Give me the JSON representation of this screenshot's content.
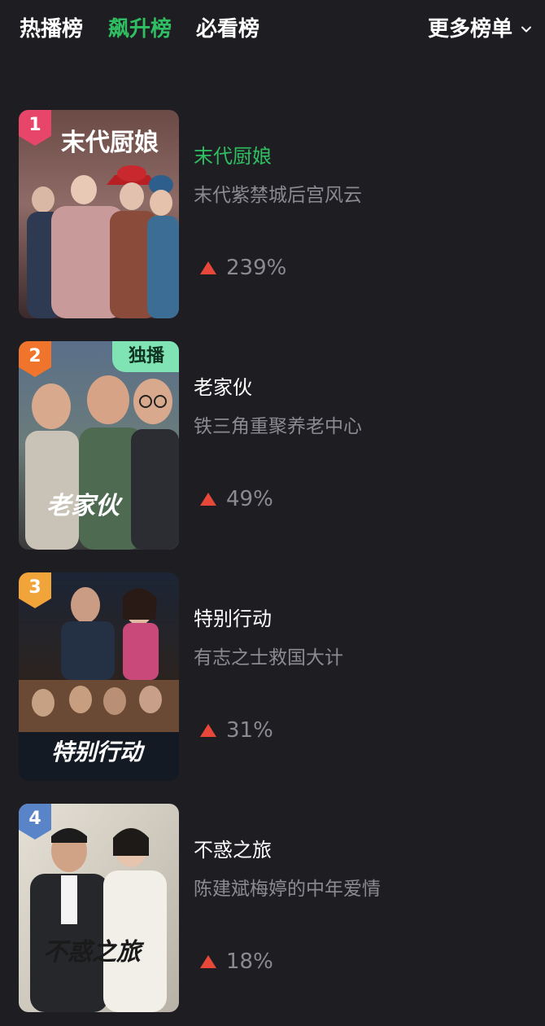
{
  "tabs": [
    {
      "label": "热播榜",
      "active": false
    },
    {
      "label": "飙升榜",
      "active": true
    },
    {
      "label": "必看榜",
      "active": false
    }
  ],
  "more": {
    "label": "更多榜单",
    "icon": "chevron-down-icon"
  },
  "colors": {
    "background": "#1e1d22",
    "accent_green": "#2fbf62",
    "muted_text": "#8b8a90",
    "trend_up": "#e8483a",
    "rank_1": "#e8456a",
    "rank_2": "#f0742c",
    "rank_3": "#f1a43a",
    "rank_4": "#5a84c8",
    "exclusive_badge": "#7fe3b3"
  },
  "items": [
    {
      "rank": "1",
      "title": "末代厨娘",
      "subtitle": "末代紫禁城后宫风云",
      "trend": "239%",
      "poster_text": "末代厨娘",
      "highlighted": true
    },
    {
      "rank": "2",
      "title": "老家伙",
      "subtitle": "铁三角重聚养老中心",
      "trend": "49%",
      "badge": "独播",
      "poster_text": "老家伙"
    },
    {
      "rank": "3",
      "title": "特别行动",
      "subtitle": "有志之士救国大计",
      "trend": "31%",
      "poster_text": "特别行动"
    },
    {
      "rank": "4",
      "title": "不惑之旅",
      "subtitle": "陈建斌梅婷的中年爱情",
      "trend": "18%",
      "poster_text": "不惑之旅"
    }
  ]
}
